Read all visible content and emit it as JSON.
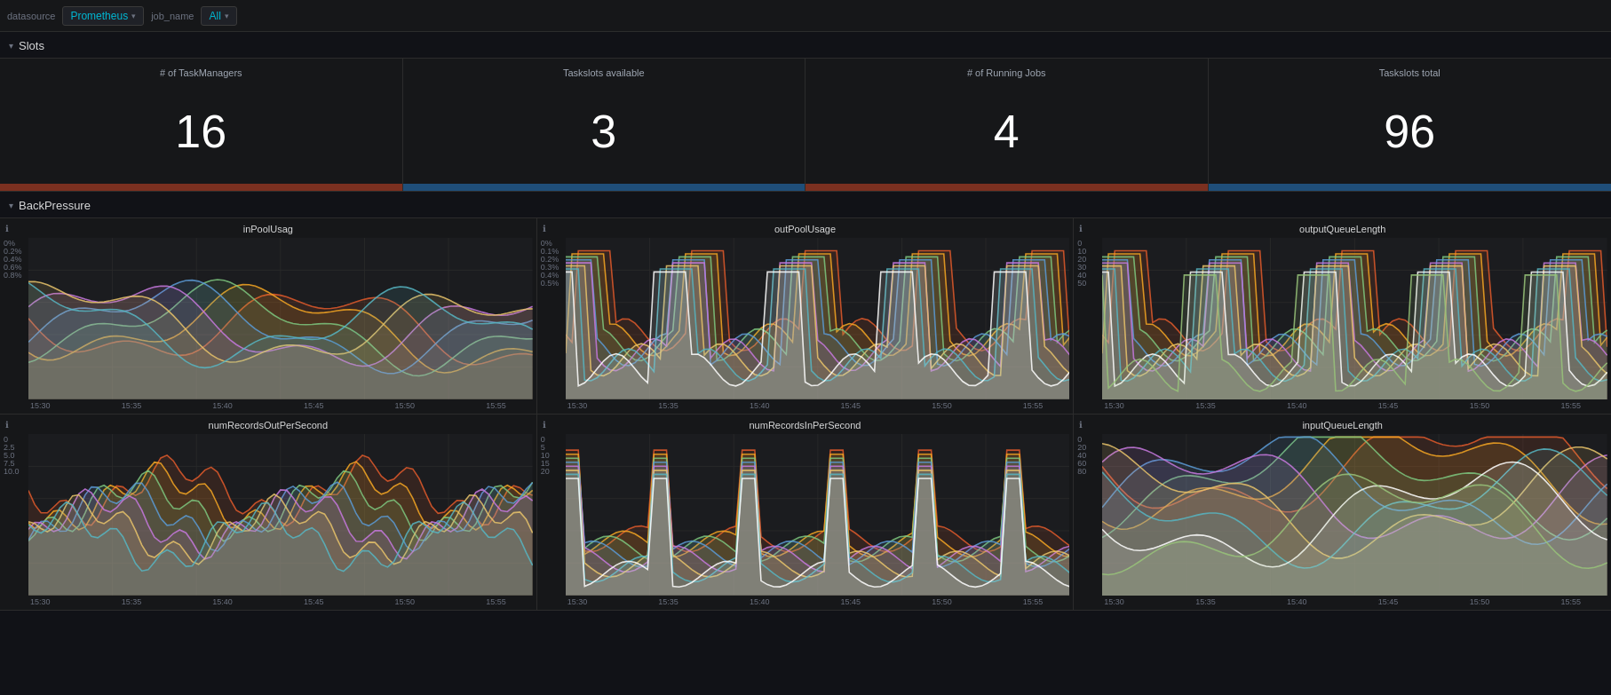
{
  "topbar": {
    "datasource_label": "datasource",
    "datasource_value": "Prometheus",
    "filter_label": "job_name",
    "filter_value": "All"
  },
  "sections": {
    "slots": {
      "label": "Slots",
      "cards": [
        {
          "title": "# of TaskManagers",
          "value": "16",
          "bar_color": "#7b3020"
        },
        {
          "title": "Taskslots available",
          "value": "3",
          "bar_color": "#1f4e79"
        },
        {
          "title": "# of Running Jobs",
          "value": "4",
          "bar_color": "#7b3020"
        },
        {
          "title": "Taskslots total",
          "value": "96",
          "bar_color": "#1f4e79"
        }
      ]
    },
    "backpressure": {
      "label": "BackPressure",
      "charts": [
        {
          "title": "inPoolUsag",
          "y_labels": [
            "0.8%",
            "0.6%",
            "0.4%",
            "0.2%",
            "0%"
          ],
          "x_labels": [
            "15:30",
            "15:35",
            "15:40",
            "15:45",
            "15:50",
            "15:55"
          ]
        },
        {
          "title": "outPoolUsage",
          "y_labels": [
            "0.5%",
            "0.4%",
            "0.3%",
            "0.2%",
            "0.1%",
            "0%"
          ],
          "x_labels": [
            "15:30",
            "15:35",
            "15:40",
            "15:45",
            "15:50",
            "15:55"
          ]
        },
        {
          "title": "outputQueueLength",
          "y_labels": [
            "50",
            "40",
            "30",
            "20",
            "10",
            "0"
          ],
          "x_labels": [
            "15:30",
            "15:35",
            "15:40",
            "15:45",
            "15:50",
            "15:55"
          ]
        },
        {
          "title": "numRecordsOutPerSecond",
          "y_labels": [
            "10.0",
            "7.5",
            "5.0",
            "2.5",
            "0"
          ],
          "x_labels": [
            "15:30",
            "15:35",
            "15:40",
            "15:45",
            "15:50",
            "15:55"
          ]
        },
        {
          "title": "numRecordsInPerSecond",
          "y_labels": [
            "20",
            "15",
            "10",
            "5",
            "0"
          ],
          "x_labels": [
            "15:30",
            "15:35",
            "15:40",
            "15:45",
            "15:50",
            "15:55"
          ]
        },
        {
          "title": "inputQueueLength",
          "y_labels": [
            "80",
            "60",
            "40",
            "20",
            "0"
          ],
          "x_labels": [
            "15:30",
            "15:35",
            "15:40",
            "15:45",
            "15:50",
            "15:55"
          ]
        }
      ]
    }
  }
}
